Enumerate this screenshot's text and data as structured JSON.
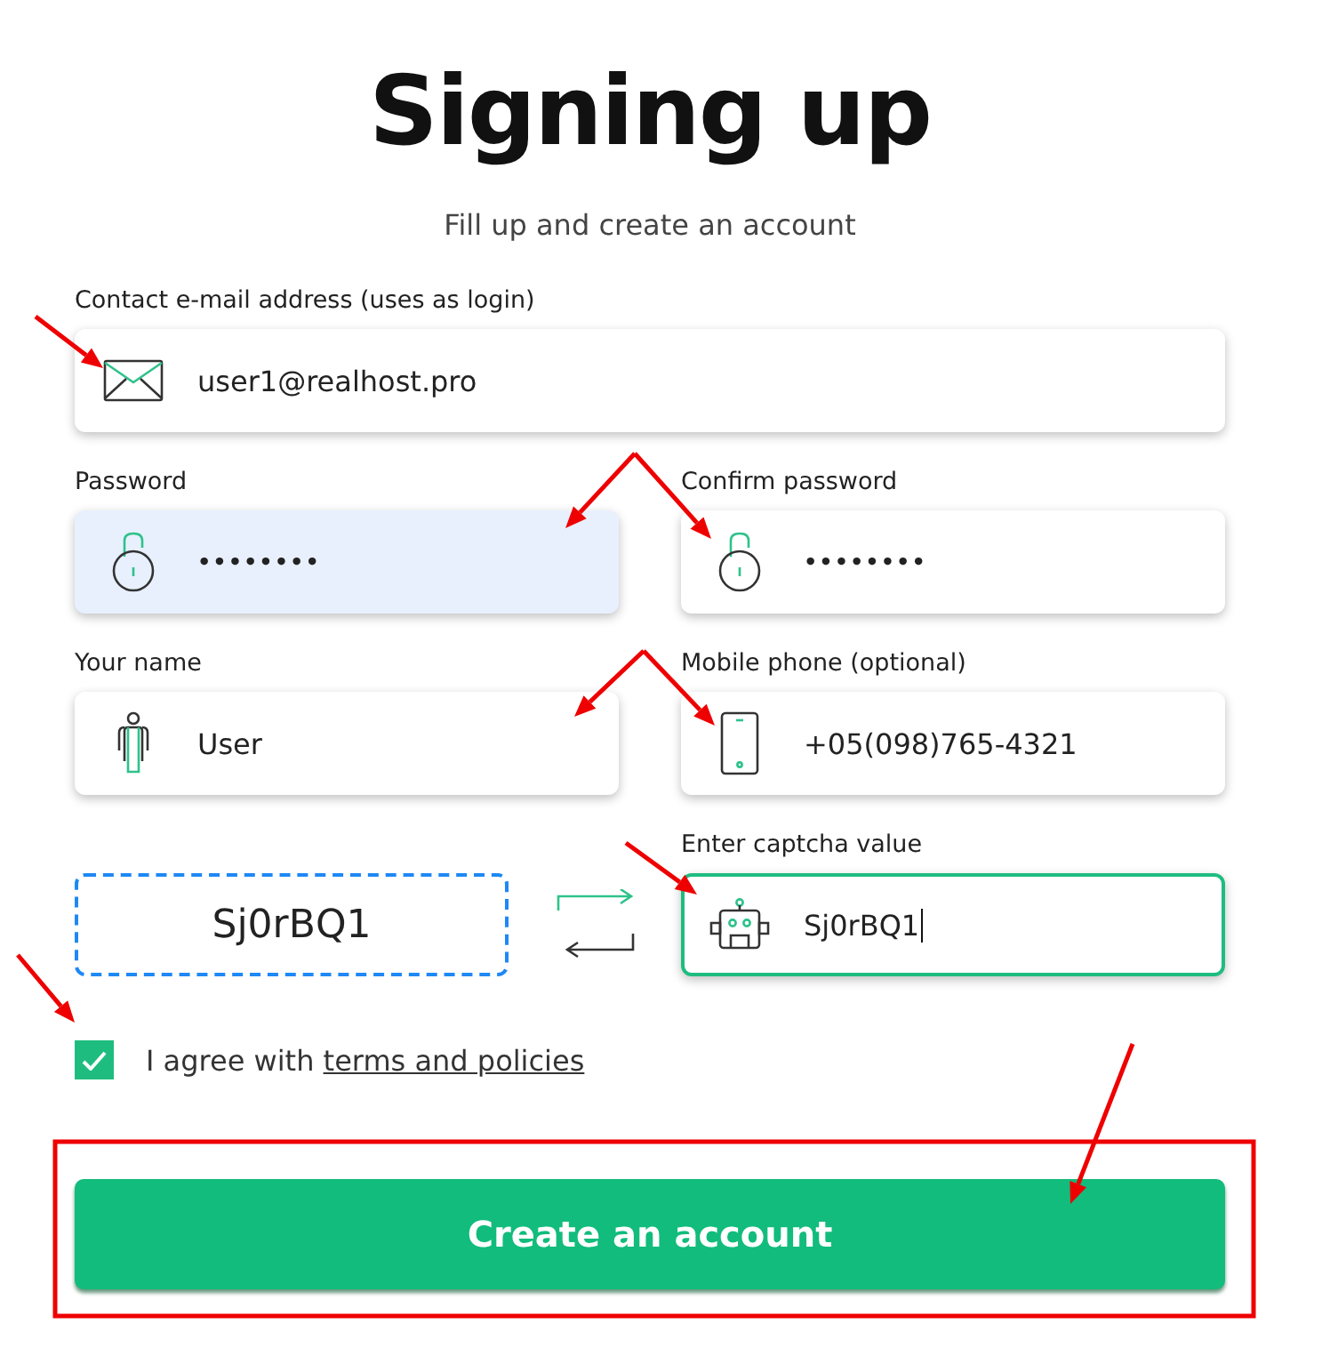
{
  "title": "Signing up",
  "subtitle": "Fill up and create an account",
  "fields": [
    {
      "kind": "email",
      "label": "Contact e-mail address (uses as login)",
      "value": "user1@realhost.pro",
      "autofilled": false,
      "focused": false
    },
    {
      "kind": "password",
      "label": "Password",
      "value": "••••••••",
      "autofilled": true,
      "focused": false
    },
    {
      "kind": "password",
      "label": "Confirm password",
      "value": "••••••••",
      "autofilled": false,
      "focused": false
    },
    {
      "kind": "name",
      "label": "Your name",
      "value": "User",
      "autofilled": false,
      "focused": false
    },
    {
      "kind": "phone",
      "label": "Mobile phone (optional)",
      "value": "+05(098)765-4321",
      "autofilled": false,
      "focused": false
    }
  ],
  "captcha": {
    "code": "Sj0rBQ1",
    "label": "Enter captcha value",
    "value": "Sj0rBQ1",
    "focused": true
  },
  "agreement": {
    "checked": true,
    "text": "I agree with",
    "link": "terms and policies"
  },
  "submit": "Create an account",
  "annotations": [
    {
      "kind": "arrow"
    },
    {
      "kind": "arrow"
    },
    {
      "kind": "arrow"
    },
    {
      "kind": "arrow"
    },
    {
      "kind": "arrow"
    },
    {
      "kind": "arrow"
    },
    {
      "kind": "arrow"
    },
    {
      "kind": "arrow"
    },
    {
      "kind": "frame"
    }
  ]
}
